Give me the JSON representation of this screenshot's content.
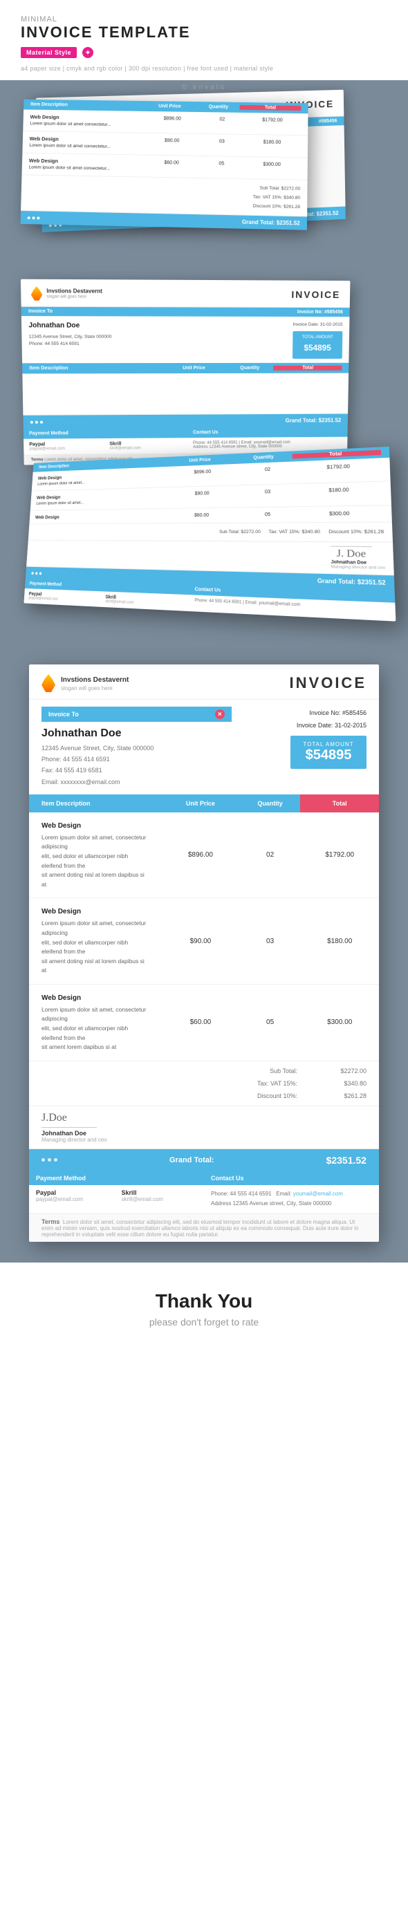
{
  "header": {
    "minimal_label": "Minimal",
    "title": "INVOICE TEMPLATE",
    "badge_material": "Material Style",
    "tagline": "a4 paper size | cmyk and rgb color | 300 dpi resolution | free font used | material style"
  },
  "watermark": "© envato",
  "preview1": {
    "company_name": "Invstions Destavernt",
    "company_sub": "slogan will goes here",
    "invoice_label": "INVOICE",
    "invoice_to_label": "Invoice To",
    "client_name": "Johnathan Doe",
    "client_address": "12345 Avenue Street, City, State 000000\nPhone: 44 555 414 6591\nEmail: xxxxxxx@email.com",
    "invoice_no_label": "Invoice No:",
    "invoice_no": "#585456",
    "invoice_date_label": "Invoice Date:",
    "invoice_date": "31-02-2015",
    "total_label": "TOTAL AMOUNT",
    "total_amount": "$54895",
    "table": {
      "headers": [
        "Item Description",
        "Unit Price",
        "Quantity",
        "Total"
      ],
      "rows": [
        {
          "name": "Web Design",
          "desc": "Lorem ipsum dolor sit amet, consectetur adipiscing elit, sed dolor et ullamcorper nibh eleifend from the sit",
          "price": "$896.00",
          "qty": "02",
          "total": "$1792.00"
        },
        {
          "name": "Web Design",
          "desc": "Lorem ipsum dolor sit amet, consectetur adipiscing elit, sed dolor et ullamcorper nibh eleifend from the sit",
          "price": "$90.00",
          "qty": "03",
          "total": "$180.00"
        },
        {
          "name": "Web Design",
          "desc": "Lorem ipsum dolor sit amet, consectetur adipiscing elit, sed dolor et ullamcorper nibh eleifend from the sit",
          "price": "$60.00",
          "qty": "05",
          "total": "$300.00"
        }
      ],
      "sub_total_label": "Sub Total:",
      "sub_total": "$2272.00",
      "tax_label": "Tax: VAT 15%:",
      "tax": "$340.80",
      "discount_label": "Discount 10%:",
      "discount": "$261.28",
      "grand_total_label": "Grand Total:",
      "grand_total": "$2351.52"
    },
    "signature": {
      "name": "Johnathan Doe",
      "title": "Managing director and ceo"
    },
    "payment": {
      "label": "Payment Method",
      "paypal_name": "Paypal",
      "paypal_email": "paypal@email.com",
      "skrill_name": "Skrill",
      "skrill_email": "skrill@email.com"
    },
    "contact": {
      "label": "Contact Us",
      "phone_label": "Phone:",
      "phone": "44 555 414 6591",
      "address": "Address 12345 Avenue street, City, State 000000",
      "email_label": "Email:",
      "email": "youmail@email.com"
    },
    "terms": {
      "label": "Terms",
      "text": "Lorem dolor sit amet, consectetur adipiscing elit, sed do eiusmod tempor incididunt ut labore et dolore magna aliqua. Ut enim ad minim veniam, quis nostrud exercitation ullamco laboris nisi ut aliquip ex ea commodo consequat. Duis aute irure dolor in reprehenderit in voluptate velit esse cillum dolore eu fugiat nulla pariatur."
    }
  },
  "thank_you": {
    "heading": "Thank You",
    "subtext": "please don't forget to rate"
  },
  "colors": {
    "blue": "#4db6e4",
    "red": "#e84c6a",
    "pink": "#e91e8c"
  }
}
